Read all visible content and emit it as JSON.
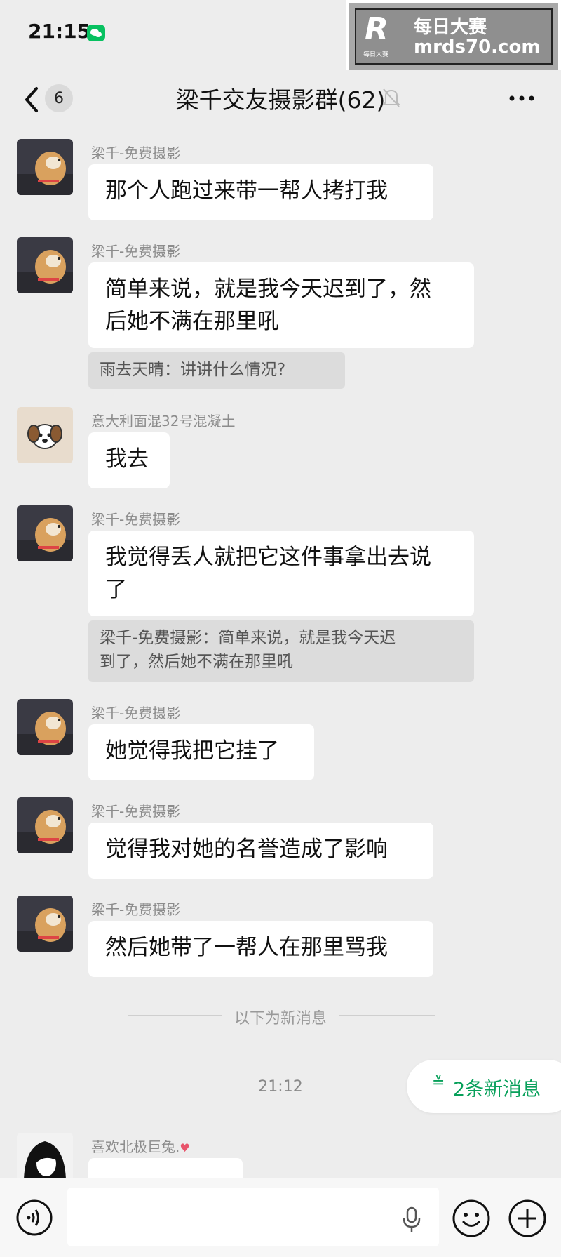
{
  "status": {
    "time": "21:15"
  },
  "watermark": {
    "logo": "R",
    "title": "每日大赛",
    "domain": "mrds70.com",
    "sub": "每日大赛"
  },
  "nav": {
    "unread": "6",
    "title": "梁千交友摄影群(62)"
  },
  "messages": [
    {
      "sender": "梁千-免费摄影",
      "text": "那个人跑过来带一帮人拷打我"
    },
    {
      "sender": "梁千-免费摄影",
      "lines": [
        "简单来说，就是我今天迟到了，然",
        "后她不满在那里吼"
      ],
      "quote": "雨去天晴：讲讲什么情况?"
    },
    {
      "sender": "意大利面混32号混凝土",
      "text": "我去"
    },
    {
      "sender": "梁千-免费摄影",
      "lines": [
        "我觉得丢人就把它这件事拿出去说",
        "了"
      ],
      "quote_lines": [
        "梁千-免费摄影：简单来说，就是我今天迟",
        "到了，然后她不满在那里吼"
      ]
    },
    {
      "sender": "梁千-免费摄影",
      "text": "她觉得我把它挂了"
    },
    {
      "sender": "梁千-免费摄影",
      "text": "觉得我对她的名誉造成了影响"
    },
    {
      "sender": "梁千-免费摄影",
      "text": "然后她带了一帮人在那里骂我"
    },
    {
      "sender": "喜欢北极巨兔."
    }
  ],
  "divider": "以下为新消息",
  "timestamp": "21:12",
  "new_messages": {
    "label": "2条新消息"
  },
  "input": {
    "value": ""
  },
  "icons": [
    "wechat-icon",
    "back-chevron-icon",
    "mute-bell-icon",
    "more-icon",
    "dog-avatar",
    "cartoon-dog-avatar",
    "anime-avatar",
    "heart-icon",
    "voice-icon",
    "microphone-icon",
    "emoji-icon",
    "plus-icon"
  ],
  "colors": {
    "background": "#ededed",
    "bubble": "#ffffff",
    "accent_green": "#07c160",
    "new_msg_text": "#07a05a"
  }
}
